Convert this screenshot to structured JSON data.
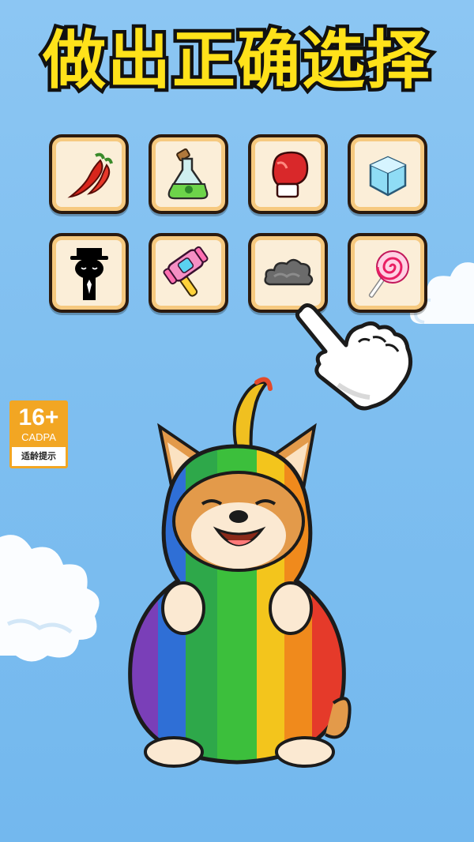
{
  "title": "做出正确选择",
  "items": [
    {
      "name": "chili-pepper-icon"
    },
    {
      "name": "potion-flask-icon"
    },
    {
      "name": "boxing-glove-icon"
    },
    {
      "name": "ice-cube-icon"
    },
    {
      "name": "shadow-man-icon"
    },
    {
      "name": "toy-hammer-icon"
    },
    {
      "name": "dark-cloud-icon"
    },
    {
      "name": "lollipop-icon"
    }
  ],
  "age_rating": {
    "number": "16+",
    "org": "CADPA",
    "tip": "适龄提示"
  },
  "colors": {
    "background": "#7fbff0",
    "title_fill": "#ffe21a",
    "tile_border": "#f6c97f",
    "tile_bg": "#fbeed8",
    "badge_orange": "#f2a623"
  }
}
